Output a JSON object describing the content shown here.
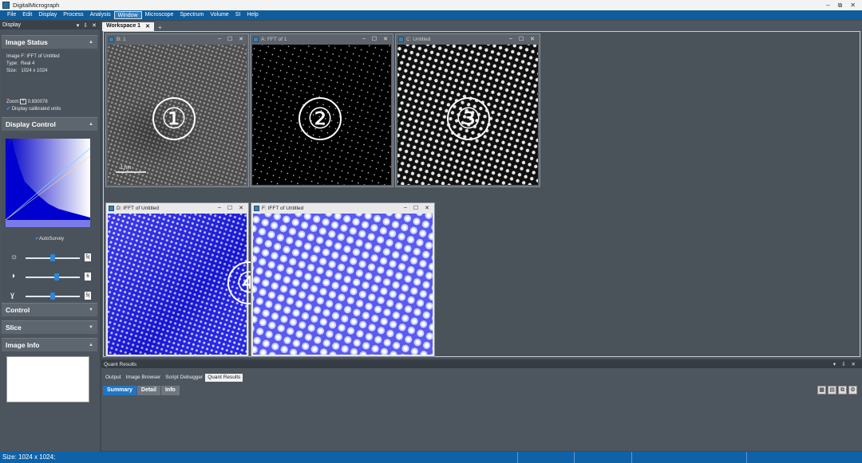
{
  "app": {
    "title": "DigitalMicrograph",
    "window_controls": [
      "–",
      "⧉",
      "✕"
    ]
  },
  "menu": [
    "File",
    "Edit",
    "Display",
    "Process",
    "Analysis",
    "Window",
    "Microscope",
    "Spectrum",
    "Volume",
    "SI",
    "Help"
  ],
  "left_panel": {
    "title": "Display",
    "controls": [
      "▾",
      "⇩",
      "✕"
    ],
    "image_status": {
      "header": "Image Status",
      "line1": "Image F: IFFT of Untitled",
      "type_label": "Type:",
      "type_value": "Real 4",
      "size_label": "Size:",
      "size_value": "1024 x 1024",
      "zoom_label": "Zoom:",
      "zoom_value": "0.830078",
      "calibrated": "Display calibrated units"
    },
    "display_control": {
      "header": "Display Control",
      "autosurvey": "AutoSurvey",
      "sliders": [
        {
          "icon": "brightness-icon",
          "glyph": "☼",
          "value": "5(",
          "level": 0.5
        },
        {
          "icon": "contrast-icon",
          "glyph": "◑",
          "value": "6",
          "level": 0.58
        },
        {
          "icon": "gamma-icon",
          "glyph": "ɣ",
          "value": "5(",
          "level": 0.5
        }
      ]
    },
    "control": "Control",
    "slice": "Slice",
    "image_info": "Image Info"
  },
  "workspace": {
    "tab_label": "Workspace 1",
    "tab_close": "✕",
    "tab_add": "+",
    "windows": [
      {
        "title": "B: 1",
        "number": "①",
        "scale_label": "1 nm"
      },
      {
        "title": "A: FFT of 1",
        "number": "②"
      },
      {
        "title": "C: Untitled",
        "number": "③"
      },
      {
        "title": "D: IFFT of Untitled",
        "number": "④"
      },
      {
        "title": "F: IFFT of Untitled"
      }
    ],
    "win_controls": [
      "–",
      "☐",
      "✕"
    ]
  },
  "bottom": {
    "title": "Quant Results",
    "controls": [
      "▾",
      "⇩",
      "✕"
    ],
    "tabs": [
      "Output",
      "Image Browser",
      "Script Debugger",
      "Quant Results"
    ],
    "subtabs": [
      "Summary",
      "Detail",
      "Info"
    ]
  },
  "status": {
    "text": "Size: 1024 x 1024;"
  }
}
